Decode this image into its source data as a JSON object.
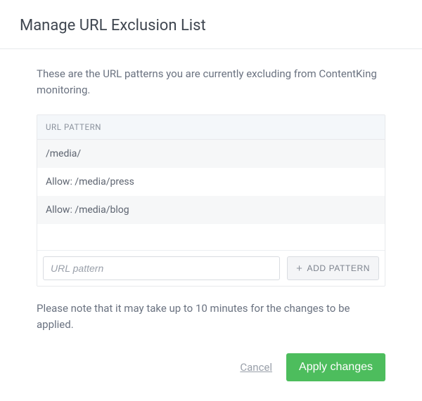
{
  "header": {
    "title": "Manage URL Exclusion List"
  },
  "intro": "These are the URL patterns you are currently excluding from ContentKing monitoring.",
  "table": {
    "header": "URL PATTERN",
    "rows": [
      "/media/",
      "Allow: /media/press",
      "Allow: /media/blog"
    ]
  },
  "add": {
    "placeholder": "URL pattern",
    "button_label": "ADD PATTERN"
  },
  "note": "Please note that it may take up to 10 minutes for the changes to be applied.",
  "actions": {
    "cancel": "Cancel",
    "apply": "Apply changes"
  }
}
